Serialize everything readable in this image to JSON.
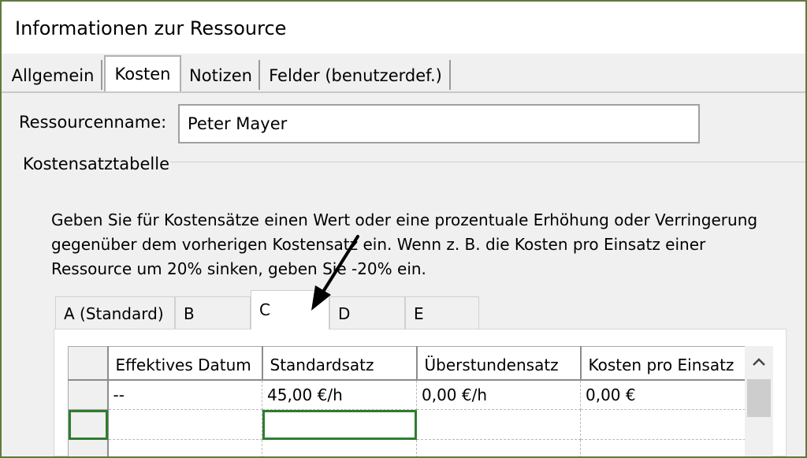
{
  "window": {
    "title": "Informationen zur Ressource"
  },
  "main_tabs": [
    {
      "label": "Allgemein"
    },
    {
      "label": "Kosten"
    },
    {
      "label": "Notizen"
    },
    {
      "label": "Felder (benutzerdef.)"
    }
  ],
  "active_main_tab": "Kosten",
  "resource": {
    "name_label": "Ressourcenname:",
    "name_value": "Peter Mayer"
  },
  "cost_table": {
    "group_label": "Kostensatztabelle",
    "description": "Geben Sie für Kostensätze einen Wert oder eine prozentuale Erhöhung oder Verringerung gegenüber dem vorherigen Kostensatz ein. Wenn z. B. die Kosten pro Einsatz einer Ressource um 20% sinken, geben Sie -20% ein.",
    "tabs": [
      {
        "label": "A (Standard)"
      },
      {
        "label": "B"
      },
      {
        "label": "C"
      },
      {
        "label": "D"
      },
      {
        "label": "E"
      }
    ],
    "active_tab": "C",
    "columns": [
      "Effektives Datum",
      "Standardsatz",
      "Überstundensatz",
      "Kosten pro Einsatz"
    ],
    "rows": [
      [
        "--",
        "45,00 €/h",
        "0,00 €/h",
        "0,00 €"
      ],
      [
        "",
        "",
        "",
        ""
      ],
      [
        "",
        "",
        "",
        ""
      ]
    ]
  },
  "colors": {
    "frame_border": "#5f7a3a",
    "selection": "#2f7d2f",
    "dialog_bg": "#f0f0f0"
  },
  "icons": {
    "scroll_up": "chevron-up-icon",
    "annotation": "arrow-annotation"
  }
}
